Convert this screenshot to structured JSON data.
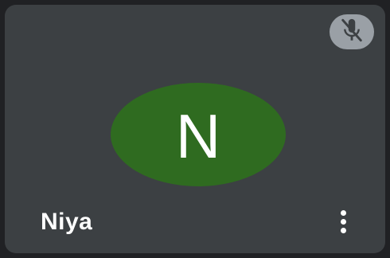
{
  "participant": {
    "name": "Niya",
    "initial": "N",
    "avatar_color": "#2f6b20",
    "mic_state": "muted",
    "mic_icon": "mic-off-icon",
    "more_icon": "more-vert-icon"
  },
  "colors": {
    "tile_background": "#3c4043",
    "mic_badge_background": "#9aa0a6",
    "icon_color": "#3c4043"
  }
}
